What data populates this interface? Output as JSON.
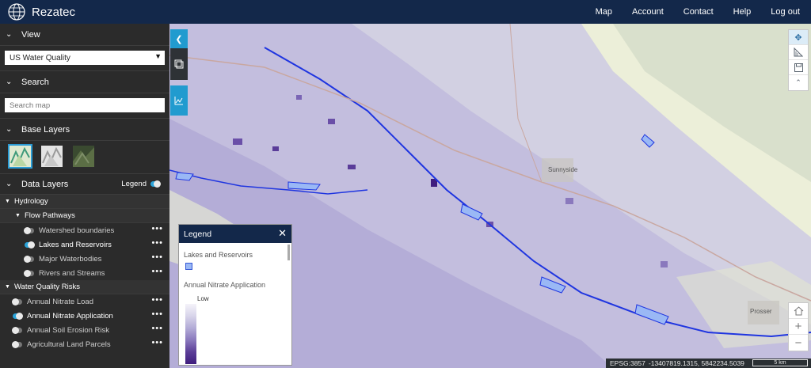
{
  "app": {
    "brand": "Rezatec"
  },
  "nav": {
    "items": [
      "Map",
      "Account",
      "Contact",
      "Help",
      "Log out"
    ]
  },
  "sidebar": {
    "view": {
      "title": "View",
      "selected": "US Water Quality"
    },
    "search": {
      "title": "Search",
      "placeholder": "Search map"
    },
    "base_layers": {
      "title": "Base Layers",
      "thumbs": [
        "terrain",
        "grey",
        "satellite"
      ]
    },
    "data_layers": {
      "title": "Data Layers",
      "legend_label": "Legend",
      "legend_on": true,
      "groups": [
        {
          "name": "Hydrology"
        },
        {
          "name": "Flow Pathways"
        },
        {
          "name": "Water Quality Risks"
        }
      ],
      "layers": [
        {
          "name": "Watershed boundaries",
          "on": false
        },
        {
          "name": "Lakes and Reservoirs",
          "on": true
        },
        {
          "name": "Major Waterbodies",
          "on": false
        },
        {
          "name": "Rivers and Streams",
          "on": false
        },
        {
          "name": "Annual Nitrate Load",
          "on": false
        },
        {
          "name": "Annual Nitrate Application",
          "on": true
        },
        {
          "name": "Annual Soil Erosion Risk",
          "on": false
        },
        {
          "name": "Agricultural Land Parcels",
          "on": false
        }
      ]
    }
  },
  "map": {
    "place_labels": [
      "Sunnyside",
      "Prosser"
    ]
  },
  "legend_panel": {
    "title": "Legend",
    "close": "✕",
    "items": [
      {
        "label": "Lakes and Reservoirs"
      },
      {
        "label": "Annual Nitrate Application",
        "ramp_low": "Low"
      }
    ]
  },
  "status": {
    "projection": "EPSG:3857",
    "coords": "-13407819.1315, 5842234.5039",
    "scale": "5 km"
  },
  "colors": {
    "header": "#13284a",
    "accent": "#219bcf",
    "sidebar": "#2b2b2b",
    "map_base": "#ecefd9",
    "nitrate_low": "#d8d4ea",
    "nitrate_high": "#3f1d7e",
    "water": "#1f35e0"
  }
}
